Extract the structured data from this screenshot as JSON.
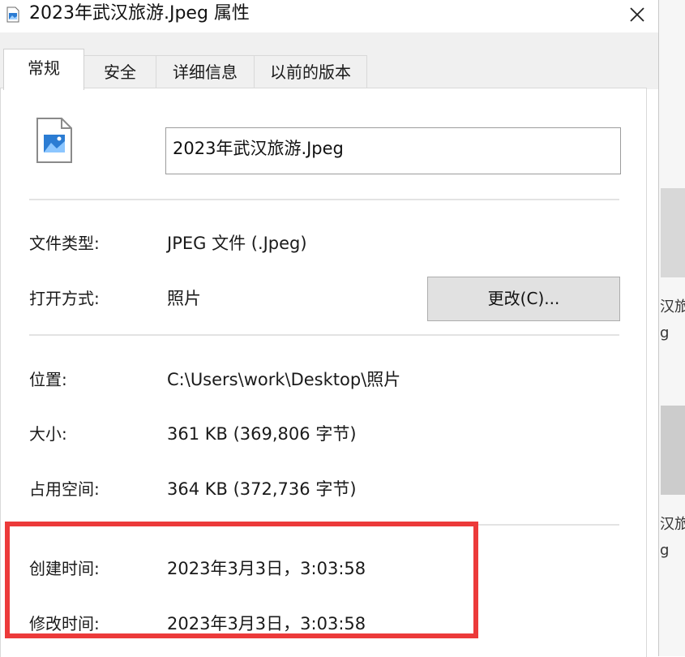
{
  "window": {
    "title": "2023年武汉旅游.Jpeg 属性",
    "icon": "image-file-icon",
    "close_icon": "close-icon"
  },
  "tabs": [
    {
      "label": "常规",
      "active": true
    },
    {
      "label": "安全",
      "active": false
    },
    {
      "label": "详细信息",
      "active": false
    },
    {
      "label": "以前的版本",
      "active": false
    }
  ],
  "general": {
    "file_name": "2023年武汉旅游.Jpeg",
    "file_type_label": "文件类型:",
    "file_type_value": "JPEG 文件 (.Jpeg)",
    "opens_with_label": "打开方式:",
    "opens_with_value": "照片",
    "change_button": "更改(C)...",
    "location_label": "位置:",
    "location_value": "C:\\Users\\work\\Desktop\\照片",
    "size_label": "大小:",
    "size_value": "361 KB (369,806 字节)",
    "size_on_disk_label": "占用空间:",
    "size_on_disk_value": "364 KB (372,736 字节)",
    "created_label": "创建时间:",
    "created_value": "2023年3月3日，3:03:58",
    "modified_label": "修改时间:",
    "modified_value": "2023年3月3日，3:03:58"
  },
  "background_window": {
    "fragments": [
      "汉旅",
      "g",
      "汉旅",
      "g"
    ]
  },
  "colors": {
    "highlight_border": "#ec3a3a",
    "icon_blue": "#2b7cd3",
    "tab_bg": "#f0f0f0"
  }
}
